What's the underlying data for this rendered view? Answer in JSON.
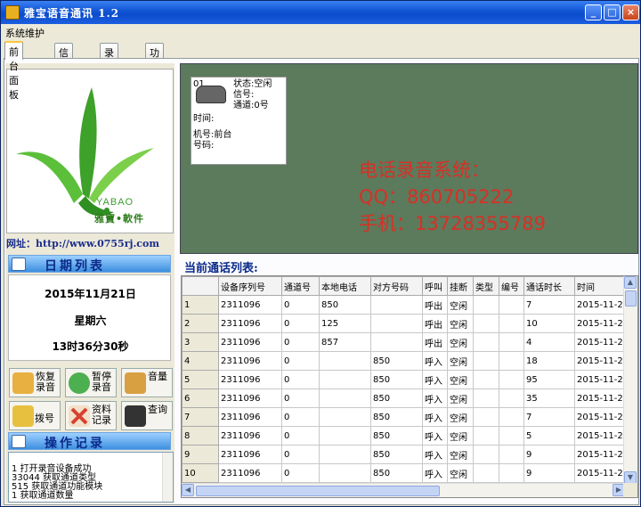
{
  "window": {
    "title": "雅宝语音通讯 1.2"
  },
  "menu": {
    "items": [
      "系统维护"
    ]
  },
  "tabs": [
    "前台面板",
    "信息记录",
    "录音查询",
    "功能控制"
  ],
  "logo": {
    "brand": "YABAO",
    "sub": "雅寶•軟件"
  },
  "url_label": "网址：http://www.0755rj.com",
  "date_section": {
    "title": "日期列表",
    "date": "2015年11月21日",
    "weekday": "星期六",
    "time": "13时36分30秒"
  },
  "buttons": [
    {
      "label": "恢复录音",
      "icon": "microphone-icon",
      "color": "#e8b040"
    },
    {
      "label": "暂停录音",
      "icon": "phone-pause-icon",
      "color": "#4caf50"
    },
    {
      "label": "音量",
      "icon": "volume-icon",
      "color": "#d8a040"
    },
    {
      "label": "拨号",
      "icon": "dial-phone-icon",
      "color": "#e8c040"
    },
    {
      "label": "资料记录",
      "icon": "record-icon",
      "color": "#d84030"
    },
    {
      "label": "查询",
      "icon": "search-mic-icon",
      "color": "#333333"
    }
  ],
  "log_section": {
    "title": "操作记录",
    "lines": [
      "1    打开录音设备成功",
      "33044     获取通道类型",
      "515     获取通道功能模块",
      "1      获取通道数量"
    ]
  },
  "line_card": {
    "id": "01",
    "status": "状态:空闲",
    "signal": "信号:",
    "channel": "通道:0号",
    "time": "时间:",
    "machine": "机号:前台",
    "number": "号码:"
  },
  "promo": [
    "电话录音系统：",
    "QQ：860705222",
    "手机：13728355789"
  ],
  "call_list": {
    "title": "当前通话列表:",
    "columns": [
      "设备序列号",
      "通道号",
      "本地电话",
      "对方号码",
      "呼叫",
      "挂断",
      "类型",
      "编号",
      "通话时长",
      "时间"
    ],
    "rows": [
      [
        "1",
        "2311096",
        "0",
        "850",
        "",
        "呼出",
        "空闲",
        "",
        "",
        "7",
        "2015-11-2"
      ],
      [
        "2",
        "2311096",
        "0",
        "125",
        "",
        "呼出",
        "空闲",
        "",
        "",
        "10",
        "2015-11-2"
      ],
      [
        "3",
        "2311096",
        "0",
        "857",
        "",
        "呼出",
        "空闲",
        "",
        "",
        "4",
        "2015-11-2"
      ],
      [
        "4",
        "2311096",
        "0",
        "",
        "850",
        "呼入",
        "空闲",
        "",
        "",
        "18",
        "2015-11-2"
      ],
      [
        "5",
        "2311096",
        "0",
        "",
        "850",
        "呼入",
        "空闲",
        "",
        "",
        "95",
        "2015-11-2"
      ],
      [
        "6",
        "2311096",
        "0",
        "",
        "850",
        "呼入",
        "空闲",
        "",
        "",
        "35",
        "2015-11-2"
      ],
      [
        "7",
        "2311096",
        "0",
        "",
        "850",
        "呼入",
        "空闲",
        "",
        "",
        "7",
        "2015-11-2"
      ],
      [
        "8",
        "2311096",
        "0",
        "",
        "850",
        "呼入",
        "空闲",
        "",
        "",
        "5",
        "2015-11-2"
      ],
      [
        "9",
        "2311096",
        "0",
        "",
        "850",
        "呼入",
        "空闲",
        "",
        "",
        "9",
        "2015-11-2"
      ],
      [
        "10",
        "2311096",
        "0",
        "",
        "850",
        "呼入",
        "空闲",
        "",
        "",
        "9",
        "2015-11-2"
      ]
    ]
  },
  "colors": {
    "titlebar": "#0b4ccc",
    "monitor_bg": "#5c7a5c",
    "promo_text": "#d83025",
    "section_title": "#0b2a8a"
  }
}
